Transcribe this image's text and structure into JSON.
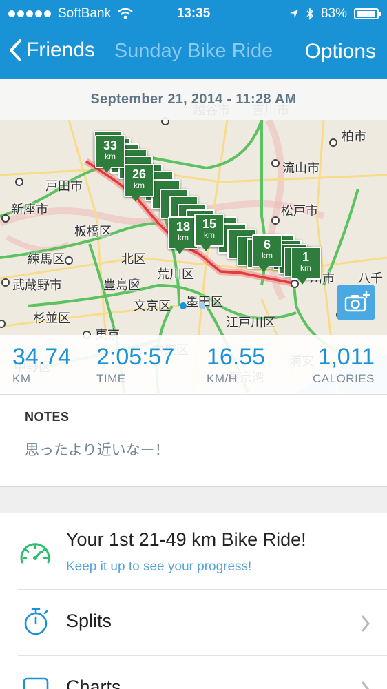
{
  "status_bar": {
    "carrier": "SoftBank",
    "time": "13:35",
    "battery": "83%"
  },
  "nav": {
    "back_label": "Friends",
    "title": "Sunday Bike Ride",
    "options_label": "Options"
  },
  "activity": {
    "date": "September 21, 2014 - 11:28 AM"
  },
  "map": {
    "places": [
      "戸田市",
      "新座市",
      "板橋区",
      "練馬区",
      "北区",
      "荒川区",
      "武蔵野市",
      "豊島区",
      "文京区",
      "墨田区",
      "杉並区",
      "東京",
      "江戸川区",
      "柏市",
      "流山市",
      "松戸市",
      "川市",
      "越谷市",
      "吉川市",
      "八千",
      "浦安",
      "東京湾",
      "中央区",
      "中野区"
    ],
    "km_markers": [
      "33",
      "26",
      "18",
      "15",
      "6",
      "1"
    ]
  },
  "stats": [
    {
      "value": "34.74",
      "label": "KM"
    },
    {
      "value": "2:05:57",
      "label": "TIME"
    },
    {
      "value": "16.55",
      "label": "KM/H"
    },
    {
      "value": "1,011",
      "label": "CALORIES"
    }
  ],
  "notes": {
    "heading": "NOTES",
    "text": "思ったより近いなー！"
  },
  "achievement": {
    "title": "Your 1st 21-49 km Bike Ride!",
    "subtitle": "Keep it up to see your progress!"
  },
  "menu": [
    {
      "label": "Splits"
    },
    {
      "label": "Charts"
    }
  ],
  "colors": {
    "accent": "#1a92d6",
    "achievement_green": "#2bbf6c",
    "marker_green": "#2e7d3c"
  }
}
